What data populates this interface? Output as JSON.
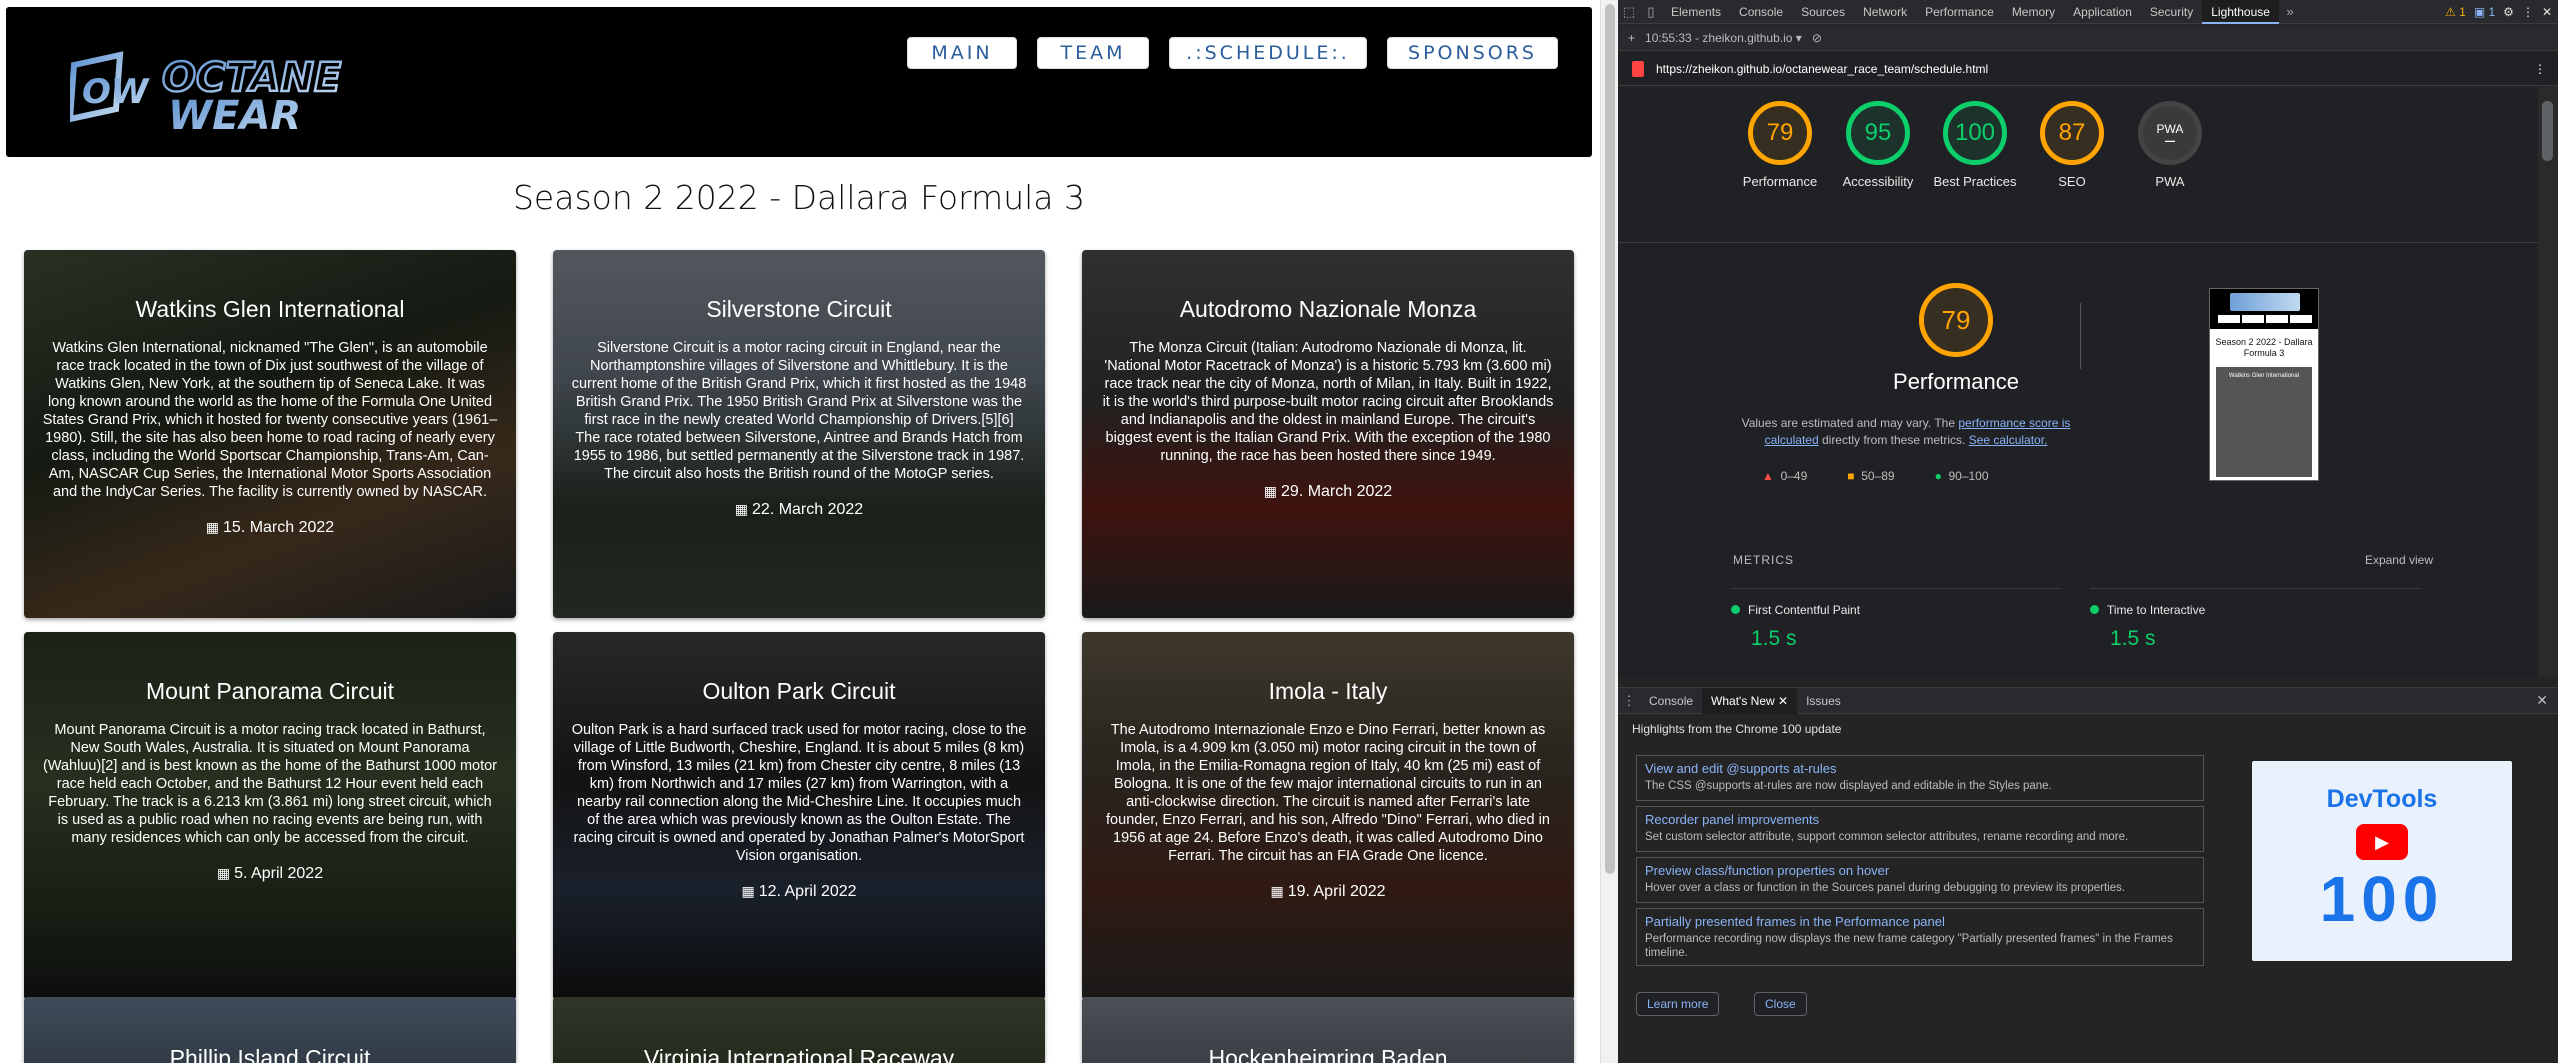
{
  "site": {
    "logo_alt": "OCTANE WEAR",
    "logo_monogram": "OW",
    "logo_line1": "OCTANE",
    "logo_line2": "WEAR",
    "nav": [
      "MAIN",
      "TEAM",
      ".:SCHEDULE:.",
      "SPONSORS"
    ],
    "season_title": "Season 2 2022 - Dallara Formula 3",
    "cards": [
      {
        "title": "Watkins Glen International",
        "text": "Watkins Glen International, nicknamed \"The Glen\", is an automobile race track located in the town of Dix just southwest of the village of Watkins Glen, New York, at the southern tip of Seneca Lake. It was long known around the world as the home of the Formula One United States Grand Prix, which it hosted for twenty consecutive years (1961–1980). Still, the site has also been home to road racing of nearly every class, including the World Sportscar Championship, Trans-Am, Can-Am, NASCAR Cup Series, the International Motor Sports Association and the IndyCar Series. The facility is currently owned by NASCAR.",
        "date": "15. March 2022"
      },
      {
        "title": "Silverstone Circuit",
        "text": "Silverstone Circuit is a motor racing circuit in England, near the Northamptonshire villages of Silverstone and Whittlebury. It is the current home of the British Grand Prix, which it first hosted as the 1948 British Grand Prix. The 1950 British Grand Prix at Silverstone was the first race in the newly created World Championship of Drivers.[5][6] The race rotated between Silverstone, Aintree and Brands Hatch from 1955 to 1986, but settled permanently at the Silverstone track in 1987. The circuit also hosts the British round of the MotoGP series.",
        "date": "22. March 2022"
      },
      {
        "title": "Autodromo Nazionale Monza",
        "text": "The Monza Circuit (Italian: Autodromo Nazionale di Monza, lit. 'National Motor Racetrack of Monza') is a historic 5.793 km (3.600 mi) race track near the city of Monza, north of Milan, in Italy. Built in 1922, it is the world's third purpose-built motor racing circuit after Brooklands and Indianapolis and the oldest in mainland Europe. The circuit's biggest event is the Italian Grand Prix. With the exception of the 1980 running, the race has been hosted there since 1949.",
        "date": "29. March 2022"
      },
      {
        "title": "Mount Panorama Circuit",
        "text": "Mount Panorama Circuit is a motor racing track located in Bathurst, New South Wales, Australia. It is situated on Mount Panorama (Wahluu)[2] and is best known as the home of the Bathurst 1000 motor race held each October, and the Bathurst 12 Hour event held each February. The track is a 6.213 km (3.861 mi) long street circuit, which is used as a public road when no racing events are being run, with many residences which can only be accessed from the circuit.",
        "date": "5. April 2022"
      },
      {
        "title": "Oulton Park Circuit",
        "text": "Oulton Park is a hard surfaced track used for motor racing, close to the village of Little Budworth, Cheshire, England. It is about 5 miles (8 km) from Winsford, 13 miles (21 km) from Chester city centre, 8 miles (13 km) from Northwich and 17 miles (27 km) from Warrington, with a nearby rail connection along the Mid-Cheshire Line. It occupies much of the area which was previously known as the Oulton Estate. The racing circuit is owned and operated by Jonathan Palmer's MotorSport Vision organisation.",
        "date": "12. April 2022"
      },
      {
        "title": "Imola - Italy",
        "text": "The Autodromo Internazionale Enzo e Dino Ferrari, better known as Imola, is a 4.909 km (3.050 mi) motor racing circuit in the town of Imola, in the Emilia-Romagna region of Italy, 40 km (25 mi) east of Bologna. It is one of the few major international circuits to run in an anti-clockwise direction. The circuit is named after Ferrari's late founder, Enzo Ferrari, and his son, Alfredo \"Dino\" Ferrari, who died in 1956 at age 24. Before Enzo's death, it was called Autodromo Dino Ferrari. The circuit has an FIA Grade One licence.",
        "date": "19. April 2022"
      },
      {
        "title": "Phillip Island Circuit",
        "text": "",
        "date": ""
      },
      {
        "title": "Virginia International Raceway",
        "text": "",
        "date": ""
      },
      {
        "title": "Hockenheimring Baden",
        "text": "",
        "date": ""
      }
    ]
  },
  "devtools": {
    "tabs": [
      "Elements",
      "Console",
      "Sources",
      "Network",
      "Performance",
      "Memory",
      "Application",
      "Security",
      "Lighthouse"
    ],
    "active_tab": "Lighthouse",
    "warnings": "1",
    "messages": "1",
    "toolbar_time": "10:55:33 - zheikon.github.io",
    "url": "https://zheikon.github.io/octanewear_race_team/schedule.html",
    "scores": [
      {
        "label": "Performance",
        "value": "79",
        "color": "orange"
      },
      {
        "label": "Accessibility",
        "value": "95",
        "color": "green"
      },
      {
        "label": "Best Practices",
        "value": "100",
        "color": "green"
      },
      {
        "label": "SEO",
        "value": "87",
        "color": "orange"
      },
      {
        "label": "PWA",
        "value": "PWA",
        "color": "grey"
      }
    ],
    "perf": {
      "score": "79",
      "title": "Performance",
      "desc_1": "Values are estimated and may vary. The ",
      "desc_link_1": "performance score is calculated",
      "desc_2": " directly from these metrics. ",
      "desc_link_2": "See calculator.",
      "legend": [
        "0–49",
        "50–89",
        "90–100"
      ],
      "thumb_title": "Season 2 2022 - Dallara Formula 3",
      "thumb_card": "Watkins Glen International"
    },
    "metrics_label": "METRICS",
    "expand_view": "Expand view",
    "metrics": [
      {
        "name": "First Contentful Paint",
        "value": "1.5 s"
      },
      {
        "name": "Time to Interactive",
        "value": "1.5 s"
      }
    ],
    "drawer": {
      "tabs": [
        "Console",
        "What's New",
        "Issues"
      ],
      "active_tab": "What's New",
      "highlights": "Highlights from the Chrome 100 update",
      "news": [
        {
          "title": "View and edit @supports at-rules",
          "desc": "The CSS @supports at-rules are now displayed and editable in the Styles pane."
        },
        {
          "title": "Recorder panel improvements",
          "desc": "Set custom selector attribute, support common selector attributes, rename recording and more."
        },
        {
          "title": "Preview class/function properties on hover",
          "desc": "Hover over a class or function in the Sources panel during debugging to preview its properties."
        },
        {
          "title": "Partially presented frames in the Performance panel",
          "desc": "Performance recording now displays the new frame category \"Partially presented frames\" in the Frames timeline."
        }
      ],
      "promo_title": "DevTools",
      "promo_number": "100",
      "learn_more": "Learn more",
      "close": "Close"
    },
    "colors": {
      "orange": "#ffa400",
      "green": "#0cce6b",
      "link": "#8ab4f8"
    }
  }
}
